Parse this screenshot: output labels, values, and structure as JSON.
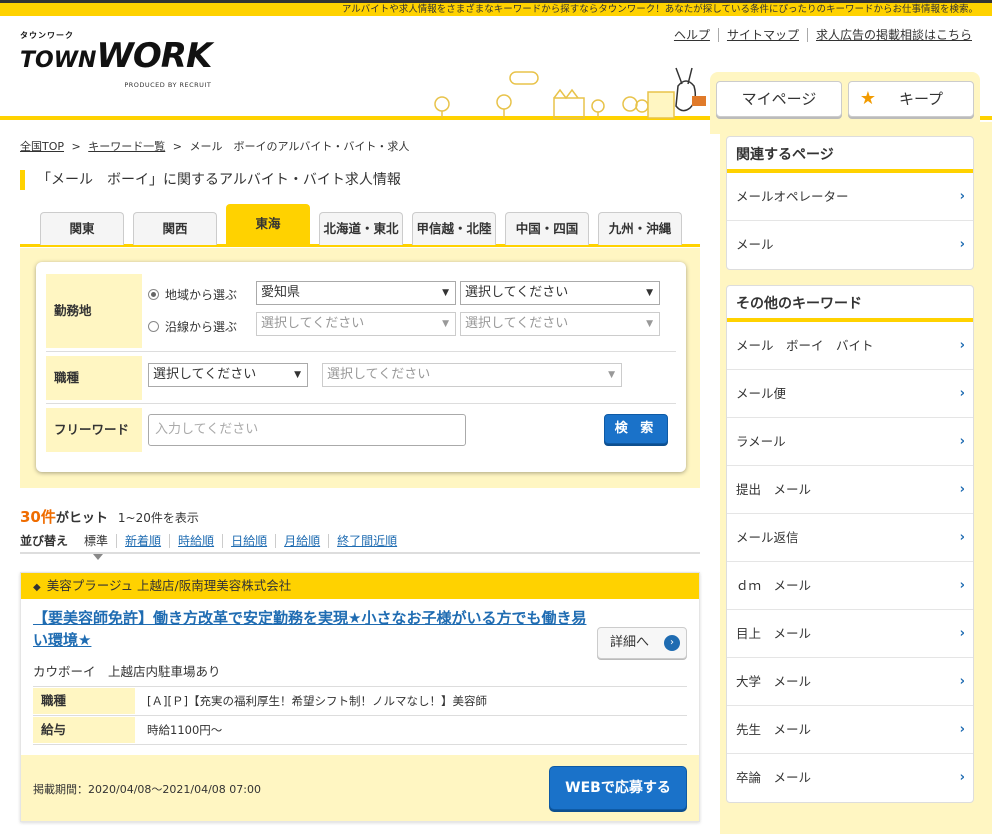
{
  "header": {
    "tagline": "アルバイトや求人情報をさまざまなキーワードから探すならタウンワーク！あなたが探している条件にぴったりのキーワードからお仕事情報を検索。",
    "logo_top": "タウンワーク",
    "logo_town": "TOWN",
    "logo_work": "WORK",
    "logo_produced": "PRODUCED BY RECRUIT",
    "links": [
      "ヘルプ",
      "サイトマップ",
      "求人広告の掲載相談はこちら"
    ],
    "mypage_label": "マイページ",
    "keep_label": "キープ"
  },
  "breadcrumb": {
    "home": "全国TOP",
    "keywords": "キーワード一覧",
    "current": "メール　ボーイのアルバイト・バイト・求人",
    "sep": ">"
  },
  "page_title": "「メール　ボーイ」に関するアルバイト・バイト求人情報",
  "tabs": [
    "関東",
    "関西",
    "東海",
    "北海道・東北",
    "甲信越・北陸",
    "中国・四国",
    "九州・沖縄"
  ],
  "search": {
    "location_label": "勤務地",
    "by_area_label": "地域から選ぶ",
    "by_line_label": "沿線から選ぶ",
    "prefecture_value": "愛知県",
    "area_placeholder": "選択してください",
    "line_placeholder1": "選択してください",
    "line_placeholder2": "選択してください",
    "job_label": "職種",
    "job_placeholder1": "選択してください",
    "job_placeholder2": "選択してください",
    "free_label": "フリーワード",
    "free_placeholder": "入力してください",
    "search_button": "検 索"
  },
  "results": {
    "count_num": "30件",
    "count_text": "がヒット",
    "range": "1~20件を表示"
  },
  "sort": {
    "label": "並び替え",
    "options": [
      "標準",
      "新着順",
      "時給順",
      "日給順",
      "月給順",
      "終了間近順"
    ]
  },
  "job": {
    "company": "美容プラージュ 上越店/阪南理美容株式会社",
    "title": "【要美容師免許】働き方改革で安定勤務を実現★小さなお子様がいる方でも働き易い環境★",
    "detail_button": "詳細へ",
    "subtitle": "カウボーイ　上越店内駐車場あり",
    "rows": [
      {
        "key": "職種",
        "value": "[Ａ][Ｐ]【充実の福利厚生！希望シフト制！ノルマなし！】美容師"
      },
      {
        "key": "給与",
        "value": "時給1100円～"
      }
    ],
    "period": "掲載期間：2020/04/08～2021/04/08 07:00",
    "apply_button": "WEBで応募する"
  },
  "sidebar": {
    "related_title": "関連するページ",
    "related": [
      "メールオペレーター",
      "メール"
    ],
    "other_title": "その他のキーワード",
    "other": [
      "メール　ボーイ　バイト",
      "メール便",
      "ラメール",
      "提出　メール",
      "メール返信",
      "ｄｍ　メール",
      "目上　メール",
      "大学　メール",
      "先生　メール",
      "卒論　メール"
    ]
  },
  "colors": {
    "accent": "#ffd200",
    "panel": "#fff6c2",
    "link": "#1f6cb2",
    "button": "#1a72c9",
    "highlight": "#ef6c00"
  }
}
